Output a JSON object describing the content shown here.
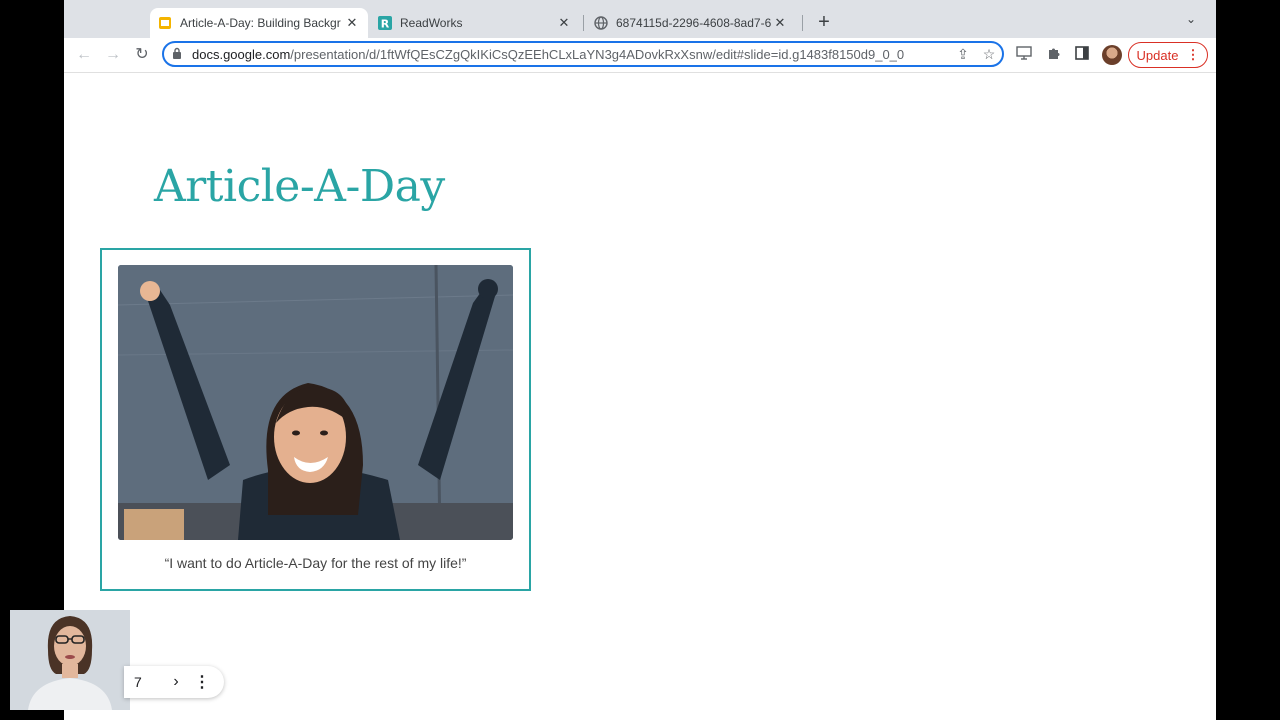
{
  "browser": {
    "tabs": [
      {
        "title": "Article-A-Day: Building Backgr",
        "icon": "google-slides-icon",
        "active": true
      },
      {
        "title": "ReadWorks",
        "icon": "readworks-icon",
        "active": false
      },
      {
        "title": "6874115d-2296-4608-8ad7-6",
        "icon": "globe-icon",
        "active": false
      }
    ],
    "new_tab_label": "+",
    "address": {
      "host": "docs.google.com",
      "path": "/presentation/d/1ftWfQEsCZgQkIKiCsQzEEhCLxLaYN3g4ADovkRxXsnw/edit#slide=id.g1483f8150d9_0_0"
    },
    "update_label": "Update",
    "accent": "#1a73e8"
  },
  "slide": {
    "title": "Article-A-Day",
    "caption": "“I want to do Article-A-Day for the rest of my life!”",
    "accent_color": "#2aa5a5"
  },
  "presenter": {
    "slide_number": "7"
  }
}
